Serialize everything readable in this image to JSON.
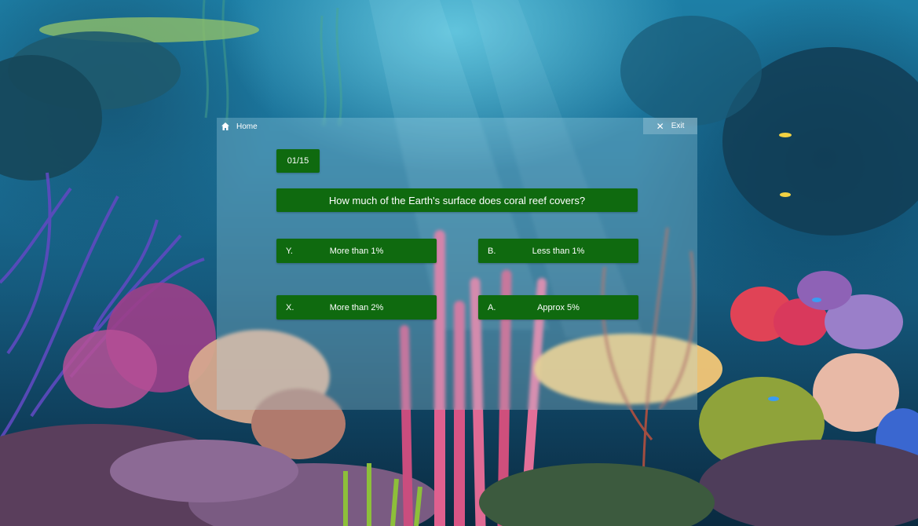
{
  "nav": {
    "home_label": "Home",
    "exit_label": "Exit"
  },
  "quiz": {
    "counter": "01/15",
    "question": "How much of the Earth's surface does coral reef covers?",
    "options": [
      {
        "key": "Y.",
        "text": "More than 1%"
      },
      {
        "key": "B.",
        "text": "Less than 1%"
      },
      {
        "key": "X.",
        "text": "More than 2%"
      },
      {
        "key": "A.",
        "text": "Approx 5%"
      }
    ]
  },
  "colors": {
    "button_green": "#0f6a0f",
    "panel_overlay": "rgba(180,225,240,0.28)",
    "text": "#ffffff"
  },
  "icons": {
    "home": "home-icon",
    "exit": "close-icon"
  }
}
